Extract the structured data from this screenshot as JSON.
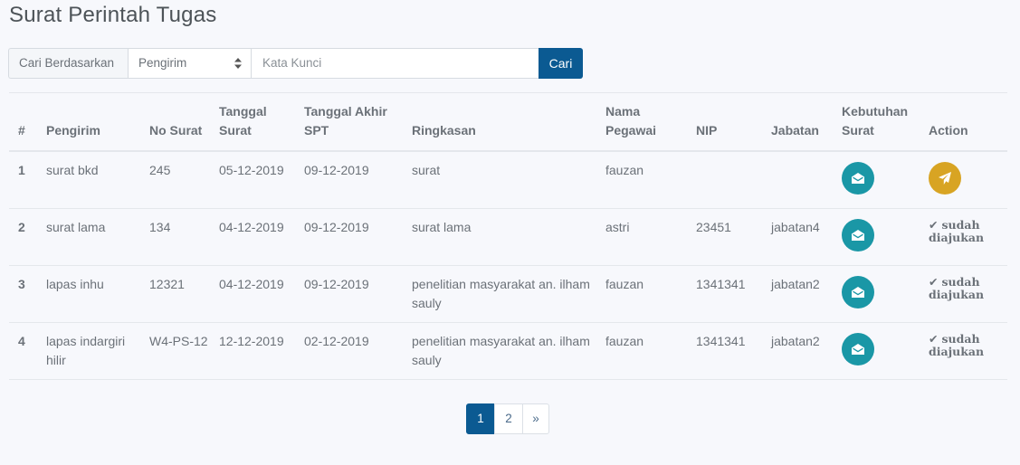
{
  "page": {
    "title": "Surat Perintah Tugas"
  },
  "search": {
    "by_label": "Cari Berdasarkan",
    "selected_field": "Pengirim",
    "keyword_placeholder": "Kata Kunci",
    "button_label": "Cari"
  },
  "table": {
    "headers": {
      "num": "#",
      "sender": "Pengirim",
      "letter_no": "No Surat",
      "letter_date": "Tanggal Surat",
      "spt_end_date": "Tanggal Akhir SPT",
      "summary": "Ringkasan",
      "employee_name": "Nama Pegawai",
      "nip": "NIP",
      "position": "Jabatan",
      "letter_need": "Kebutuhan Surat",
      "action": "Action"
    },
    "rows": [
      {
        "num": "1",
        "sender": "surat bkd",
        "letter_no": "245",
        "letter_date": "05-12-2019",
        "spt_end_date": "09-12-2019",
        "summary": "surat",
        "employee_name": "fauzan",
        "nip": "",
        "position": "",
        "status": ""
      },
      {
        "num": "2",
        "sender": "surat lama",
        "letter_no": "134",
        "letter_date": "04-12-2019",
        "spt_end_date": "09-12-2019",
        "summary": "surat lama",
        "employee_name": "astri",
        "nip": "23451",
        "position": "jabatan4",
        "status": "sudah diajukan"
      },
      {
        "num": "3",
        "sender": "lapas inhu",
        "letter_no": "12321",
        "letter_date": "04-12-2019",
        "spt_end_date": "09-12-2019",
        "summary": "penelitian masyarakat an. ilham sauly",
        "employee_name": "fauzan",
        "nip": "1341341",
        "position": "jabatan2",
        "status": "sudah diajukan"
      },
      {
        "num": "4",
        "sender": "lapas indargiri hilir",
        "letter_no": "W4-PS-12",
        "letter_date": "12-12-2019",
        "spt_end_date": "02-12-2019",
        "summary": "penelitian masyarakat an. ilham sauly",
        "employee_name": "fauzan",
        "nip": "1341341",
        "position": "jabatan2",
        "status": "sudah diajukan"
      }
    ],
    "icons": {
      "letter_need": "envelope-open-icon",
      "action": "paper-plane-icon",
      "status": "check-icon"
    }
  },
  "pagination": {
    "pages": [
      "1",
      "2"
    ],
    "next": "»",
    "active": "1"
  },
  "colors": {
    "primary": "#0b5a92",
    "teal": "#1a97a6",
    "gold": "#d8a423"
  }
}
